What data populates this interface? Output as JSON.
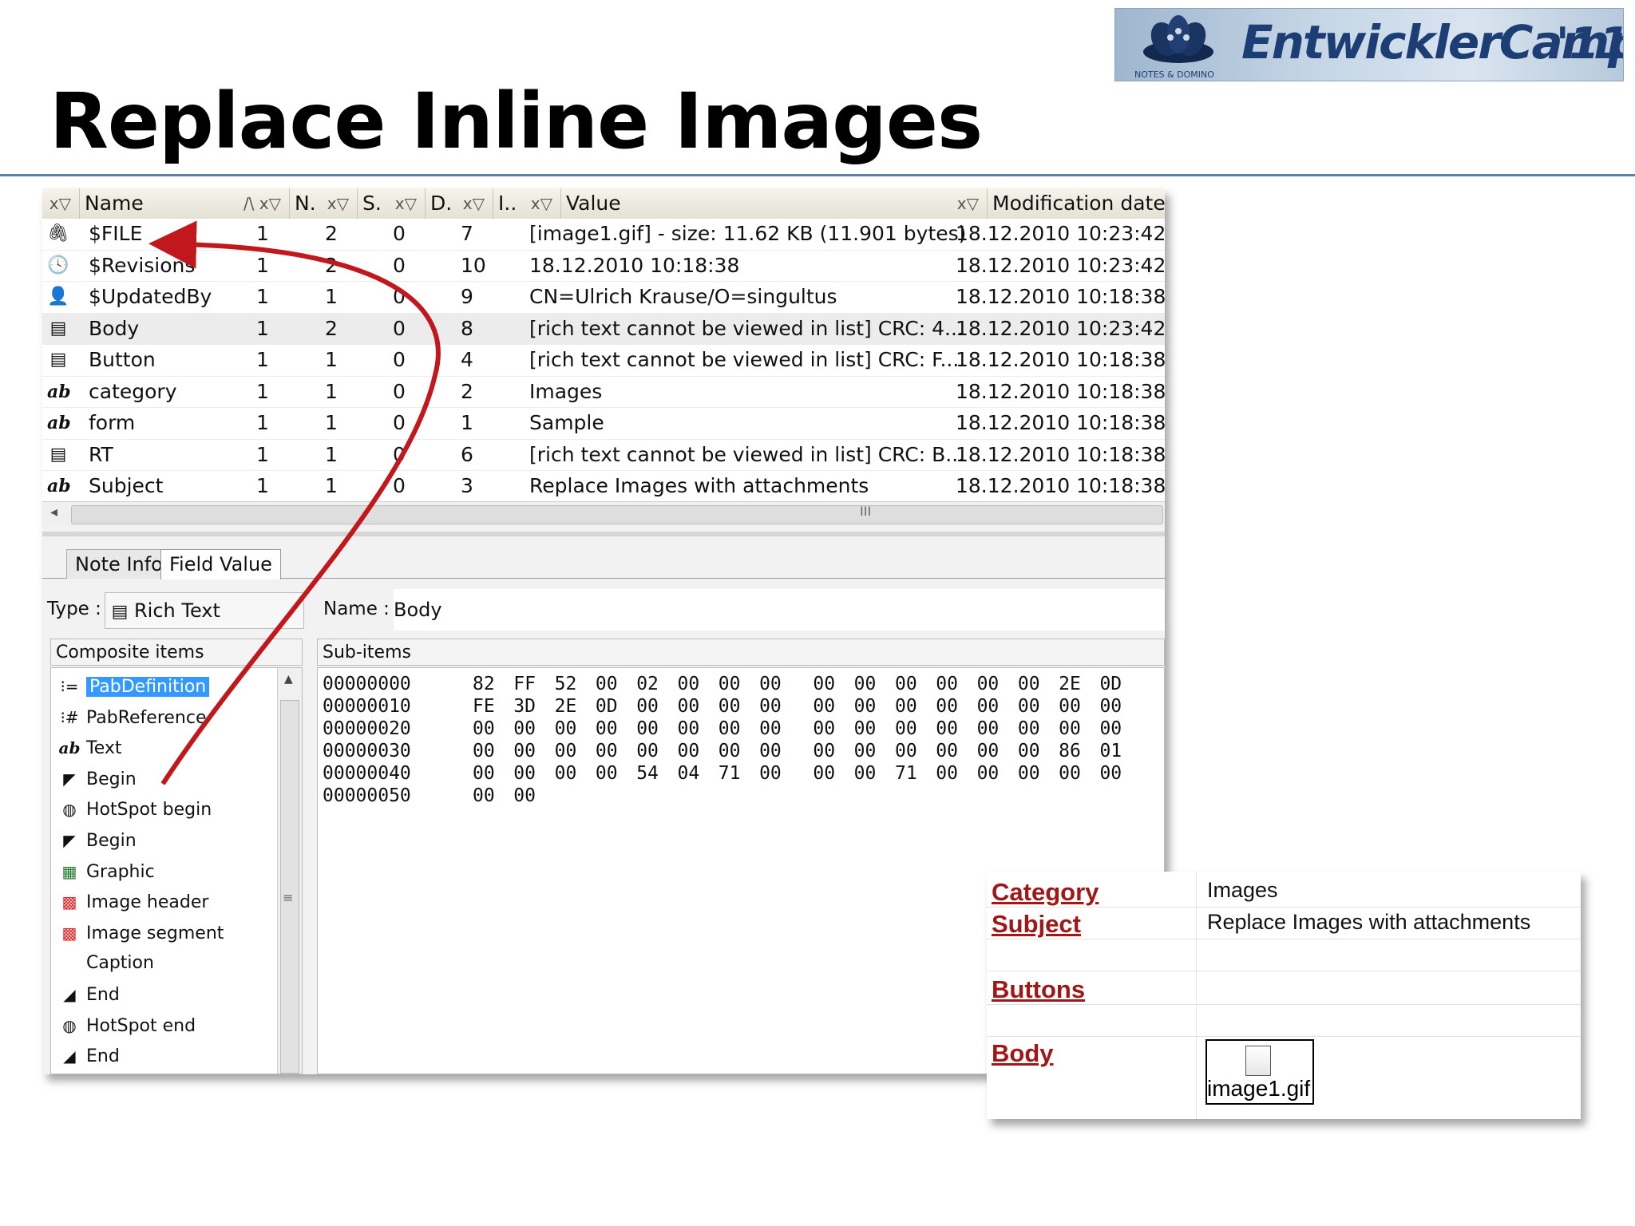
{
  "slide": {
    "title": "Replace Inline Images"
  },
  "logo": {
    "text": "EntwicklerCamp",
    "year": "'11",
    "sub": "NOTES & DOMINO"
  },
  "grid": {
    "headers": {
      "name": "Name",
      "n": "N.",
      "s": "S.",
      "d": "D.",
      "i": "I..",
      "value": "Value",
      "mod": "Modification date"
    },
    "rows": [
      {
        "icon": "paperclip-icon",
        "glyph": "🖇",
        "name": "$FILE",
        "n": "1",
        "s": "2",
        "d": "0",
        "i": "7",
        "value": "[image1.gif] - size: 11.62 KB (11.901 bytes)",
        "mod": "18.12.2010 10:23:42"
      },
      {
        "icon": "revisions-icon",
        "glyph": "🕓",
        "name": "$Revisions",
        "n": "1",
        "s": "2",
        "d": "0",
        "i": "10",
        "value": "18.12.2010 10:18:38",
        "mod": "18.12.2010 10:23:42"
      },
      {
        "icon": "user-icon",
        "glyph": "👤",
        "name": "$UpdatedBy",
        "n": "1",
        "s": "1",
        "d": "0",
        "i": "9",
        "value": "CN=Ulrich Krause/O=singultus",
        "mod": "18.12.2010 10:18:38"
      },
      {
        "icon": "richtext-icon",
        "glyph": "▤",
        "name": "Body",
        "n": "1",
        "s": "2",
        "d": "0",
        "i": "8",
        "value": "[rich text cannot be viewed in list] CRC: 4...",
        "mod": "18.12.2010 10:23:42"
      },
      {
        "icon": "richtext-icon",
        "glyph": "▤",
        "name": "Button",
        "n": "1",
        "s": "1",
        "d": "0",
        "i": "4",
        "value": "[rich text cannot be viewed in list] CRC: F...",
        "mod": "18.12.2010 10:18:38"
      },
      {
        "icon": "text-icon",
        "glyph": "ab",
        "name": "category",
        "n": "1",
        "s": "1",
        "d": "0",
        "i": "2",
        "value": "Images",
        "mod": "18.12.2010 10:18:38"
      },
      {
        "icon": "text-icon",
        "glyph": "ab",
        "name": "form",
        "n": "1",
        "s": "1",
        "d": "0",
        "i": "1",
        "value": "Sample",
        "mod": "18.12.2010 10:18:38"
      },
      {
        "icon": "richtext-icon",
        "glyph": "▤",
        "name": "RT",
        "n": "1",
        "s": "1",
        "d": "0",
        "i": "6",
        "value": "[rich text cannot be viewed in list] CRC: B...",
        "mod": "18.12.2010 10:18:38"
      },
      {
        "icon": "text-icon",
        "glyph": "ab",
        "name": "Subject",
        "n": "1",
        "s": "1",
        "d": "0",
        "i": "3",
        "value": "Replace Images with attachments",
        "mod": "18.12.2010 10:18:38"
      }
    ],
    "scroll_grip": "III"
  },
  "tabs": {
    "note_info": "Note Info",
    "field_value": "Field Value"
  },
  "field": {
    "type_label": "Type :",
    "type_value": "Rich Text",
    "name_label": "Name :",
    "name_value": "Body",
    "composite_label": "Composite items",
    "subitems_label": "Sub-items"
  },
  "composite_items": [
    {
      "icon": "pabdefinition-icon",
      "glyph": "⁝=",
      "label": "PabDefinition"
    },
    {
      "icon": "pabreference-icon",
      "glyph": "⁝#",
      "label": "PabReference"
    },
    {
      "icon": "text-icon",
      "glyph": "ab",
      "label": "Text"
    },
    {
      "icon": "begin-icon",
      "glyph": "◤",
      "label": "Begin"
    },
    {
      "icon": "hotspot-begin-icon",
      "glyph": "◍",
      "label": "HotSpot begin"
    },
    {
      "icon": "begin-icon",
      "glyph": "◤",
      "label": "Begin"
    },
    {
      "icon": "graphic-icon",
      "glyph": "▦",
      "label": "Graphic"
    },
    {
      "icon": "image-header-icon",
      "glyph": "▩",
      "label": "Image header"
    },
    {
      "icon": "image-segment-icon",
      "glyph": "▩",
      "label": "Image segment"
    },
    {
      "icon": "",
      "glyph": "",
      "label": "Caption"
    },
    {
      "icon": "end-icon",
      "glyph": "◢",
      "label": "End"
    },
    {
      "icon": "hotspot-end-icon",
      "glyph": "◍",
      "label": "HotSpot end"
    },
    {
      "icon": "end-icon",
      "glyph": "◢",
      "label": "End"
    }
  ],
  "hex_rows": [
    {
      "offset": "00000000",
      "bytes": [
        "82",
        "FF",
        "52",
        "00",
        "02",
        "00",
        "00",
        "00",
        "00",
        "00",
        "00",
        "00",
        "00",
        "00",
        "2E",
        "0D"
      ]
    },
    {
      "offset": "00000010",
      "bytes": [
        "FE",
        "3D",
        "2E",
        "0D",
        "00",
        "00",
        "00",
        "00",
        "00",
        "00",
        "00",
        "00",
        "00",
        "00",
        "00",
        "00"
      ]
    },
    {
      "offset": "00000020",
      "bytes": [
        "00",
        "00",
        "00",
        "00",
        "00",
        "00",
        "00",
        "00",
        "00",
        "00",
        "00",
        "00",
        "00",
        "00",
        "00",
        "00"
      ]
    },
    {
      "offset": "00000030",
      "bytes": [
        "00",
        "00",
        "00",
        "00",
        "00",
        "00",
        "00",
        "00",
        "00",
        "00",
        "00",
        "00",
        "00",
        "00",
        "86",
        "01"
      ]
    },
    {
      "offset": "00000040",
      "bytes": [
        "00",
        "00",
        "00",
        "00",
        "54",
        "04",
        "71",
        "00",
        "00",
        "00",
        "71",
        "00",
        "00",
        "00",
        "00",
        "00"
      ]
    },
    {
      "offset": "00000050",
      "bytes": [
        "00",
        "00"
      ]
    }
  ],
  "form": {
    "category_label": "Category",
    "category_value": "Images",
    "subject_label": "Subject",
    "subject_value": "Replace Images with attachments",
    "buttons_label": "Buttons",
    "body_label": "Body",
    "attachment_name": "image1.gif"
  },
  "colors": {
    "arrow": "#c0181c",
    "form_label": "#a11616",
    "selection": "#3399ff"
  }
}
